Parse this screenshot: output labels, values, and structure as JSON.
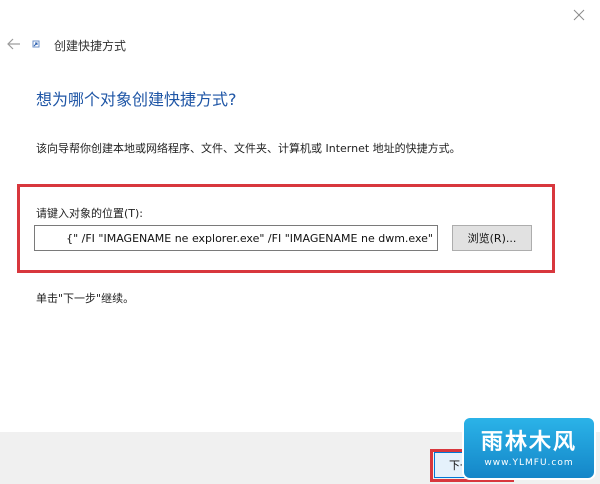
{
  "wizard": {
    "title": "创建快捷方式",
    "heading": "想为哪个对象创建快捷方式?",
    "description": "该向导帮你创建本地或网络程序、文件、文件夹、计算机或 Internet 地址的快捷方式。",
    "location_label": "请键入对象的位置(T):",
    "location_value": "{\" /FI \"IMAGENAME ne explorer.exe\" /FI \"IMAGENAME ne dwm.exe\"",
    "browse_label": "浏览(R)...",
    "continue_hint": "单击\"下一步\"继续。",
    "next_label": "下一步(N)"
  },
  "watermark": {
    "main": "雨林木风",
    "url": "www.YLMFU.com"
  },
  "icons": {
    "close": "close-icon",
    "back": "back-arrow-icon",
    "wizard": "shortcut-wizard-icon"
  },
  "colors": {
    "heading": "#1f56a6",
    "highlight": "#d8373d",
    "accent": "#0078d7"
  }
}
